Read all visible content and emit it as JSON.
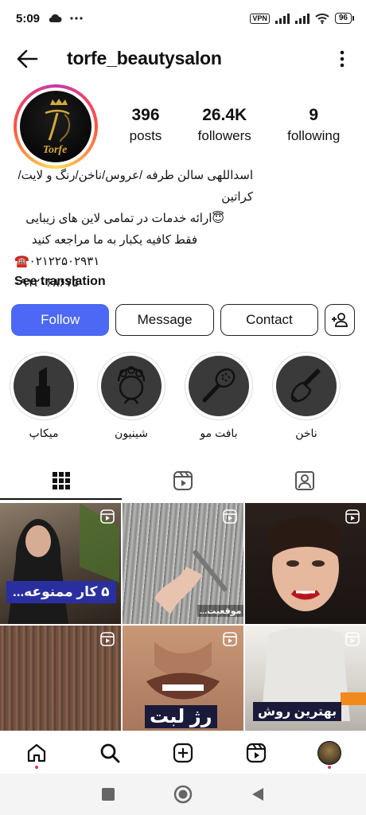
{
  "status_bar": {
    "time": "5:09",
    "vpn": "VPN",
    "battery": "96"
  },
  "header": {
    "username": "torfe_beautysalon"
  },
  "profile": {
    "logo_text": "Torfe",
    "stats": [
      {
        "value": "396",
        "label": "posts"
      },
      {
        "value": "26.4K",
        "label": "followers"
      },
      {
        "value": "9",
        "label": "following"
      }
    ],
    "bio_lines": [
      "اسداللهی سالن طرفه /عروس/ناخن/رنگ و لایت/کراتین",
      "😇ارائه خدمات در تمامی لاین های زیبایی",
      "فقط کافیه یکبار به ما مراجعه کنید",
      "☎️۰۲۱۲۲۵۰۲۹۳۱",
      "۰۹۱۲۰۶۸۶۷۵"
    ],
    "see_translation": "See translation"
  },
  "buttons": {
    "follow": "Follow",
    "message": "Message",
    "contact": "Contact"
  },
  "highlights": [
    {
      "label": "میکاپ",
      "icon": "lipstick-icon"
    },
    {
      "label": "شینیون",
      "icon": "hair-updo-icon"
    },
    {
      "label": "بافت مو",
      "icon": "hairbrush-icon"
    },
    {
      "label": "ناخن",
      "icon": "nail-polish-icon"
    }
  ],
  "grid_posts": [
    {
      "caption": "۵ کار ممنوعه...",
      "colors": [
        "#6b5a48",
        "#2a2a2a"
      ]
    },
    {
      "caption": "موقعیت...",
      "colors": [
        "#8a8a88",
        "#cfcfcf"
      ]
    },
    {
      "caption": "",
      "colors": [
        "#3a2c26",
        "#1a1412"
      ]
    },
    {
      "caption": "",
      "colors": [
        "#6b4a3a",
        "#a07a64"
      ]
    },
    {
      "caption": "رژ لبت",
      "colors": [
        "#c48a6a",
        "#8a5a44"
      ]
    },
    {
      "caption": "بهترین روش",
      "colors": [
        "#e8e6e2",
        "#b9b4ac"
      ]
    }
  ]
}
